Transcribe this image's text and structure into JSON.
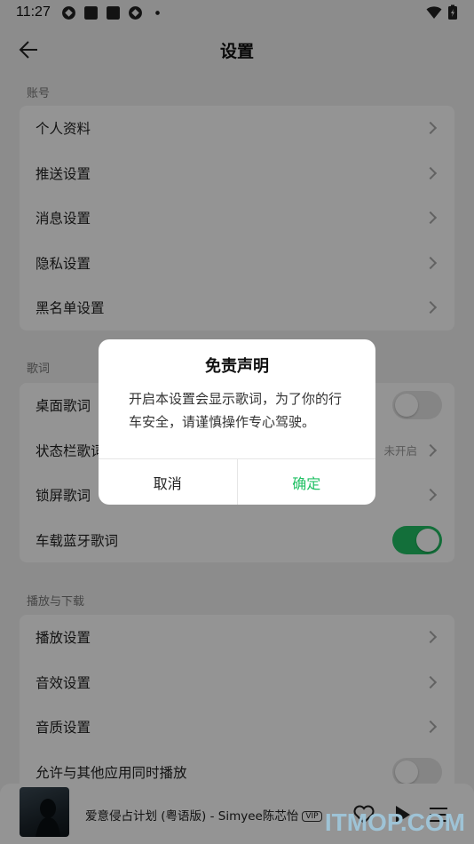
{
  "status_bar": {
    "time": "11:27"
  },
  "header": {
    "title": "设置"
  },
  "sections": {
    "account": {
      "label": "账号",
      "items": [
        "个人资料",
        "推送设置",
        "消息设置",
        "隐私设置",
        "黑名单设置"
      ]
    },
    "lyrics": {
      "label": "歌词",
      "items": [
        {
          "label": "桌面歌词",
          "toggle": false
        },
        {
          "label": "状态栏歌词",
          "hint": "未开启"
        },
        {
          "label": "锁屏歌词"
        },
        {
          "label": "车载蓝牙歌词",
          "toggle": true
        }
      ]
    },
    "playback": {
      "label": "播放与下载",
      "items": [
        {
          "label": "播放设置"
        },
        {
          "label": "音效设置"
        },
        {
          "label": "音质设置"
        },
        {
          "label": "允许与其他应用同时播放",
          "toggle": false
        }
      ]
    }
  },
  "player": {
    "song": "爱意侵占计划 (粤语版) - Simyee陈芯怡",
    "vip": "VIP"
  },
  "dialog": {
    "title": "免责声明",
    "message": "开启本设置会显示歌词，为了你的行车安全，请谨慎操作专心驾驶。",
    "cancel": "取消",
    "confirm": "确定"
  },
  "watermark": "ITMOP.COM",
  "colors": {
    "accent": "#21c064",
    "background": "#f2f2f2"
  }
}
